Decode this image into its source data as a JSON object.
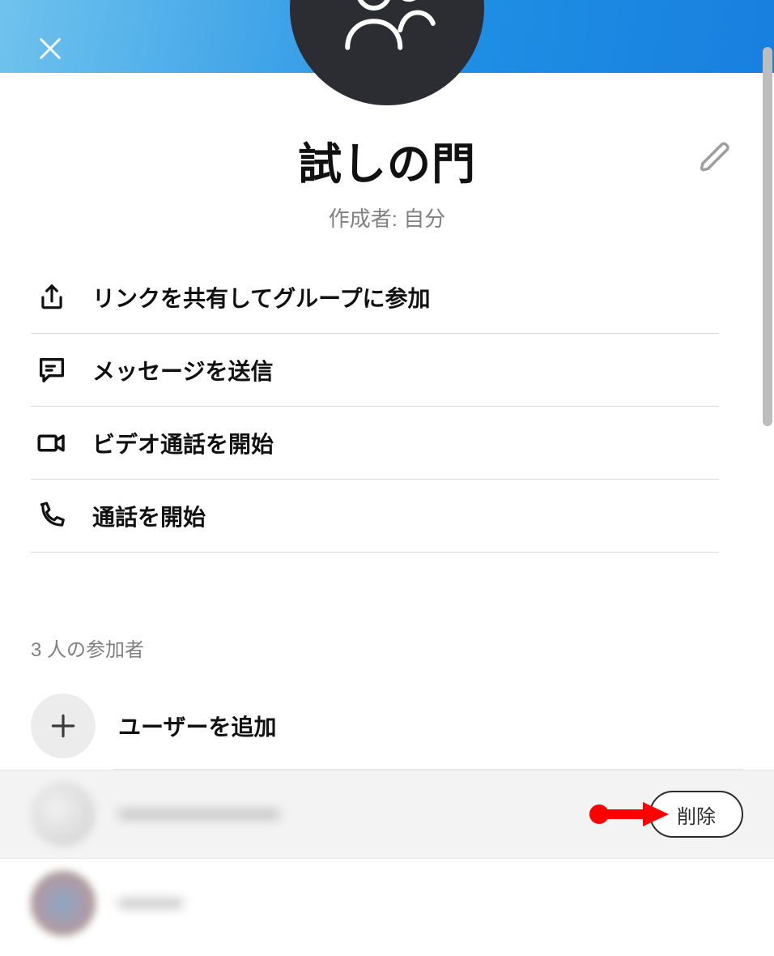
{
  "group": {
    "title": "試しの門",
    "creator_label": "作成者: 自分"
  },
  "actions": {
    "share_link": "リンクを共有してグループに参加",
    "send_message": "メッセージを送信",
    "start_video": "ビデオ通話を開始",
    "start_call": "通話を開始"
  },
  "participants_section": {
    "header": "3 人の参加者",
    "add_label": "ユーザーを追加",
    "delete_label": "削除"
  }
}
